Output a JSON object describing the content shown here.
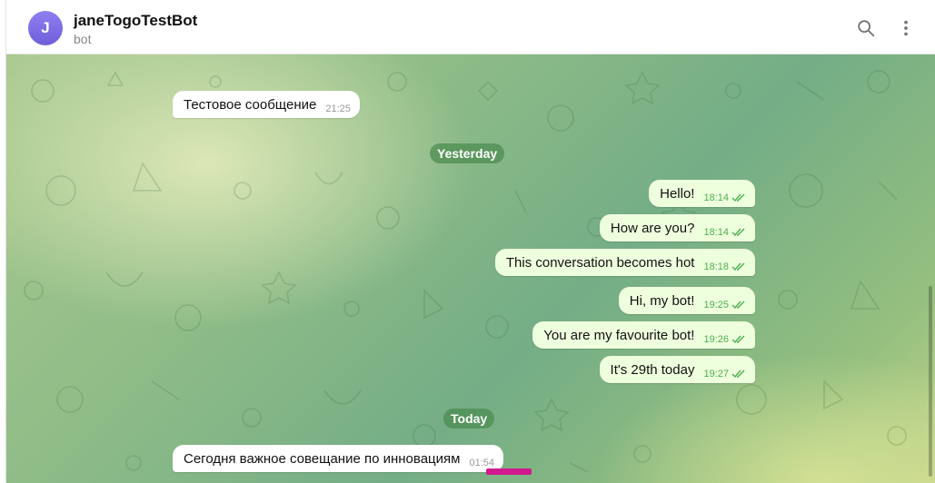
{
  "header": {
    "avatar_letter": "J",
    "title": "janeTogoTestBot",
    "subtitle": "bot",
    "search_icon": "search-icon",
    "menu_icon": "more-vertical-icon"
  },
  "colors": {
    "avatar": "#7b6ee6",
    "outgoing_bubble": "#eeffde",
    "incoming_bubble": "#ffffff",
    "time_outgoing": "#4fae4e",
    "date_pill": "#4c8c50",
    "highlight": "#d0198f"
  },
  "messages": [
    {
      "text": "Тестовое сообщение",
      "time": "21:25"
    },
    {
      "text": "Hello!",
      "time": "18:14"
    },
    {
      "text": "How are you?",
      "time": "18:14"
    },
    {
      "text": "This conversation becomes hot",
      "time": "18:18"
    },
    {
      "text": "Hi, my bot!",
      "time": "19:25"
    },
    {
      "text": "You are my favourite bot!",
      "time": "19:26"
    },
    {
      "text": "It's 29th today",
      "time": "19:27"
    },
    {
      "text": "Сегодня важное совещание по инновациям",
      "time": "01:54"
    }
  ],
  "dates": {
    "yesterday": "Yesterday",
    "today": "Today"
  }
}
